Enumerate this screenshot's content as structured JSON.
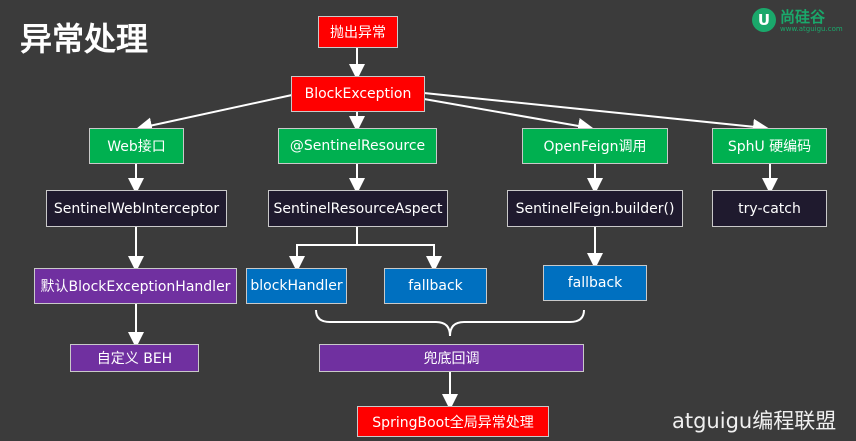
{
  "title": "异常处理",
  "logo": {
    "name": "尚硅谷",
    "url": "www.atguigu.com",
    "mark": "U"
  },
  "watermark": "atguigu编程联盟",
  "nodes": {
    "throw": "抛出异常",
    "block_exception": "BlockException",
    "web": "Web接口",
    "sentinel_resource": "@SentinelResource",
    "openfeign": "OpenFeign调用",
    "sphu": "SphU 硬编码",
    "web_interceptor": "SentinelWebInterceptor",
    "resource_aspect": "SentinelResourceAspect",
    "feign_builder": "SentinelFeign.builder()",
    "try_catch": "try-catch",
    "default_handler": "默认BlockExceptionHandler",
    "block_handler": "blockHandler",
    "fallback_resource": "fallback",
    "fallback_feign": "fallback",
    "custom_beh": "自定义 BEH",
    "fallback_group": "兜底回调",
    "global_handler": "SpringBoot全局异常处理"
  },
  "colors": {
    "background": "#3b3b3b",
    "red": "#ff0000",
    "green": "#00b050",
    "dark": "#1f1a2e",
    "blue": "#0070c0",
    "purple": "#7030a0",
    "connector": "#ffffff",
    "logo": "#1aa86b"
  }
}
